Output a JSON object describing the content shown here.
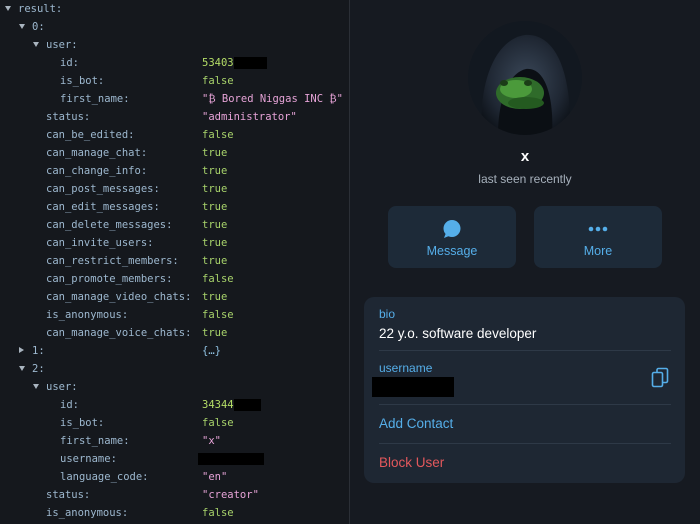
{
  "json_viewer": {
    "rows": [
      {
        "indent": 0,
        "toggle": "open",
        "key": "result:",
        "value": "",
        "type": ""
      },
      {
        "indent": 1,
        "toggle": "open",
        "key": "0:",
        "value": "",
        "type": ""
      },
      {
        "indent": 2,
        "toggle": "open",
        "key": "user:",
        "value": "",
        "type": ""
      },
      {
        "indent": 3,
        "toggle": "",
        "key": "id:",
        "value": "53403",
        "type": "number",
        "redact_w": 33
      },
      {
        "indent": 3,
        "toggle": "",
        "key": "is_bot:",
        "value": "false",
        "type": "bool"
      },
      {
        "indent": 3,
        "toggle": "",
        "key": "first_name:",
        "value": "\"₿ Bored Niggas INC ₿\"",
        "type": "string"
      },
      {
        "indent": 2,
        "toggle": "",
        "key": "status:",
        "value": "\"administrator\"",
        "type": "string"
      },
      {
        "indent": 2,
        "toggle": "",
        "key": "can_be_edited:",
        "value": "false",
        "type": "bool"
      },
      {
        "indent": 2,
        "toggle": "",
        "key": "can_manage_chat:",
        "value": "true",
        "type": "bool"
      },
      {
        "indent": 2,
        "toggle": "",
        "key": "can_change_info:",
        "value": "true",
        "type": "bool"
      },
      {
        "indent": 2,
        "toggle": "",
        "key": "can_post_messages:",
        "value": "true",
        "type": "bool"
      },
      {
        "indent": 2,
        "toggle": "",
        "key": "can_edit_messages:",
        "value": "true",
        "type": "bool"
      },
      {
        "indent": 2,
        "toggle": "",
        "key": "can_delete_messages:",
        "value": "true",
        "type": "bool"
      },
      {
        "indent": 2,
        "toggle": "",
        "key": "can_invite_users:",
        "value": "true",
        "type": "bool"
      },
      {
        "indent": 2,
        "toggle": "",
        "key": "can_restrict_members:",
        "value": "true",
        "type": "bool"
      },
      {
        "indent": 2,
        "toggle": "",
        "key": "can_promote_members:",
        "value": "false",
        "type": "bool"
      },
      {
        "indent": 2,
        "toggle": "",
        "key": "can_manage_video_chats:",
        "value": "true",
        "type": "bool"
      },
      {
        "indent": 2,
        "toggle": "",
        "key": "is_anonymous:",
        "value": "false",
        "type": "bool"
      },
      {
        "indent": 2,
        "toggle": "",
        "key": "can_manage_voice_chats:",
        "value": "true",
        "type": "bool"
      },
      {
        "indent": 1,
        "toggle": "closed",
        "key": "1:",
        "value": "{…}",
        "type": "coll"
      },
      {
        "indent": 1,
        "toggle": "open",
        "key": "2:",
        "value": "",
        "type": ""
      },
      {
        "indent": 2,
        "toggle": "open",
        "key": "user:",
        "value": "",
        "type": ""
      },
      {
        "indent": 3,
        "toggle": "",
        "key": "id:",
        "value": "34344",
        "type": "number",
        "redact_w": 27
      },
      {
        "indent": 3,
        "toggle": "",
        "key": "is_bot:",
        "value": "false",
        "type": "bool"
      },
      {
        "indent": 3,
        "toggle": "",
        "key": "first_name:",
        "value": "\"x\"",
        "type": "string"
      },
      {
        "indent": 3,
        "toggle": "",
        "key": "username:",
        "value": "",
        "type": "string",
        "redact_w": 66,
        "redact_only": true
      },
      {
        "indent": 3,
        "toggle": "",
        "key": "language_code:",
        "value": "\"en\"",
        "type": "string"
      },
      {
        "indent": 2,
        "toggle": "",
        "key": "status:",
        "value": "\"creator\"",
        "type": "string"
      },
      {
        "indent": 2,
        "toggle": "",
        "key": "is_anonymous:",
        "value": "false",
        "type": "bool"
      }
    ]
  },
  "profile": {
    "name": "x",
    "status": "last seen recently",
    "message_label": "Message",
    "more_label": "More",
    "bio_label": "bio",
    "bio_value": "22 y.o. software developer",
    "username_label": "username",
    "add_contact_label": "Add Contact",
    "block_user_label": "Block User"
  },
  "colors": {
    "accent": "#55aee9",
    "danger": "#e3585c",
    "card_bg": "#1e2733"
  },
  "icons": {
    "message": "chat-bubble-icon",
    "more": "ellipsis-icon",
    "copy": "copy-icon"
  }
}
